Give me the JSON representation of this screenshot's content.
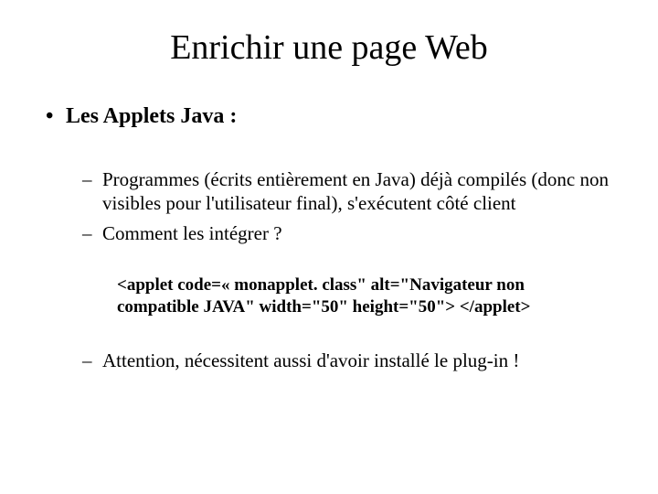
{
  "title": "Enrichir une page Web",
  "bullets": {
    "l1": "Les Applets Java :",
    "l2a": "Programmes (écrits entièrement en Java) déjà compilés (donc non visibles pour l'utilisateur final), s'exécutent côté client",
    "l2b": "Comment les intégrer ?",
    "code": "<applet code=« monapplet. class\" alt=\"Navigateur non compatible JAVA\" width=\"50\" height=\"50\"> </applet>",
    "l2c": "Attention, nécessitent aussi d'avoir installé le plug-in !"
  }
}
